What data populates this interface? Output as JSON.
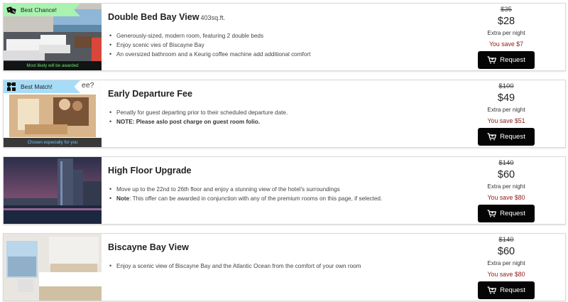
{
  "offers": [
    {
      "ribbon": "Best Chance!",
      "ribbon_icon": "dice-icon",
      "caption": "Most likely will be awarded",
      "title": "Double Bed Bay View",
      "title_sub": "403sq.ft.",
      "bullets": [
        {
          "strong": "",
          "text": "Generously-sized, modern room, featuring 2 double beds"
        },
        {
          "strong": "",
          "text": "Enjoy scenic vies of Biscayne Bay"
        },
        {
          "strong": "",
          "text": "An oversized bathroom and a Keurig coffee machine add additional comfort"
        }
      ],
      "old_price": "$35",
      "price": "$28",
      "price_note": "Extra per night",
      "savings": "You save $7",
      "button": "Request"
    },
    {
      "ribbon": "Best Match!",
      "ribbon_icon": "puzzle-icon",
      "thumb_overlay_text": "ee?",
      "caption": "Chosen especially for you",
      "title": "Early Departure Fee",
      "title_sub": "",
      "bullets": [
        {
          "strong": "",
          "text": "Penatly for guest departing prior to their scheduled departure date."
        },
        {
          "strong": "NOTE: Please aslo post charge on guest room folio.",
          "text": ""
        }
      ],
      "old_price": "$100",
      "price": "$49",
      "price_note": "Extra per night",
      "savings": "You save $51",
      "button": "Request"
    },
    {
      "ribbon": "",
      "caption": "",
      "title": "High Floor Upgrade",
      "title_sub": "",
      "bullets": [
        {
          "strong": "",
          "text": "Move up to the 22nd to 26th floor and enjoy a stunning view of the hotel's surroundings"
        },
        {
          "strong": "Note",
          "text": ": This offer can be awarded in conjunction with any of the premium rooms on this page, if selected."
        }
      ],
      "old_price": "$140",
      "price": "$60",
      "price_note": "Extra per night",
      "savings": "You save $80",
      "button": "Request"
    },
    {
      "ribbon": "",
      "caption": "",
      "title": "Biscayne Bay View",
      "title_sub": "",
      "bullets": [
        {
          "strong": "",
          "text": "Enjoy a scenic view of Biscayne Bay and the Atlantic Ocean from the comfort of your own room"
        }
      ],
      "old_price": "$140",
      "price": "$60",
      "price_note": "Extra per night",
      "savings": "You save $80",
      "button": "Request"
    }
  ]
}
